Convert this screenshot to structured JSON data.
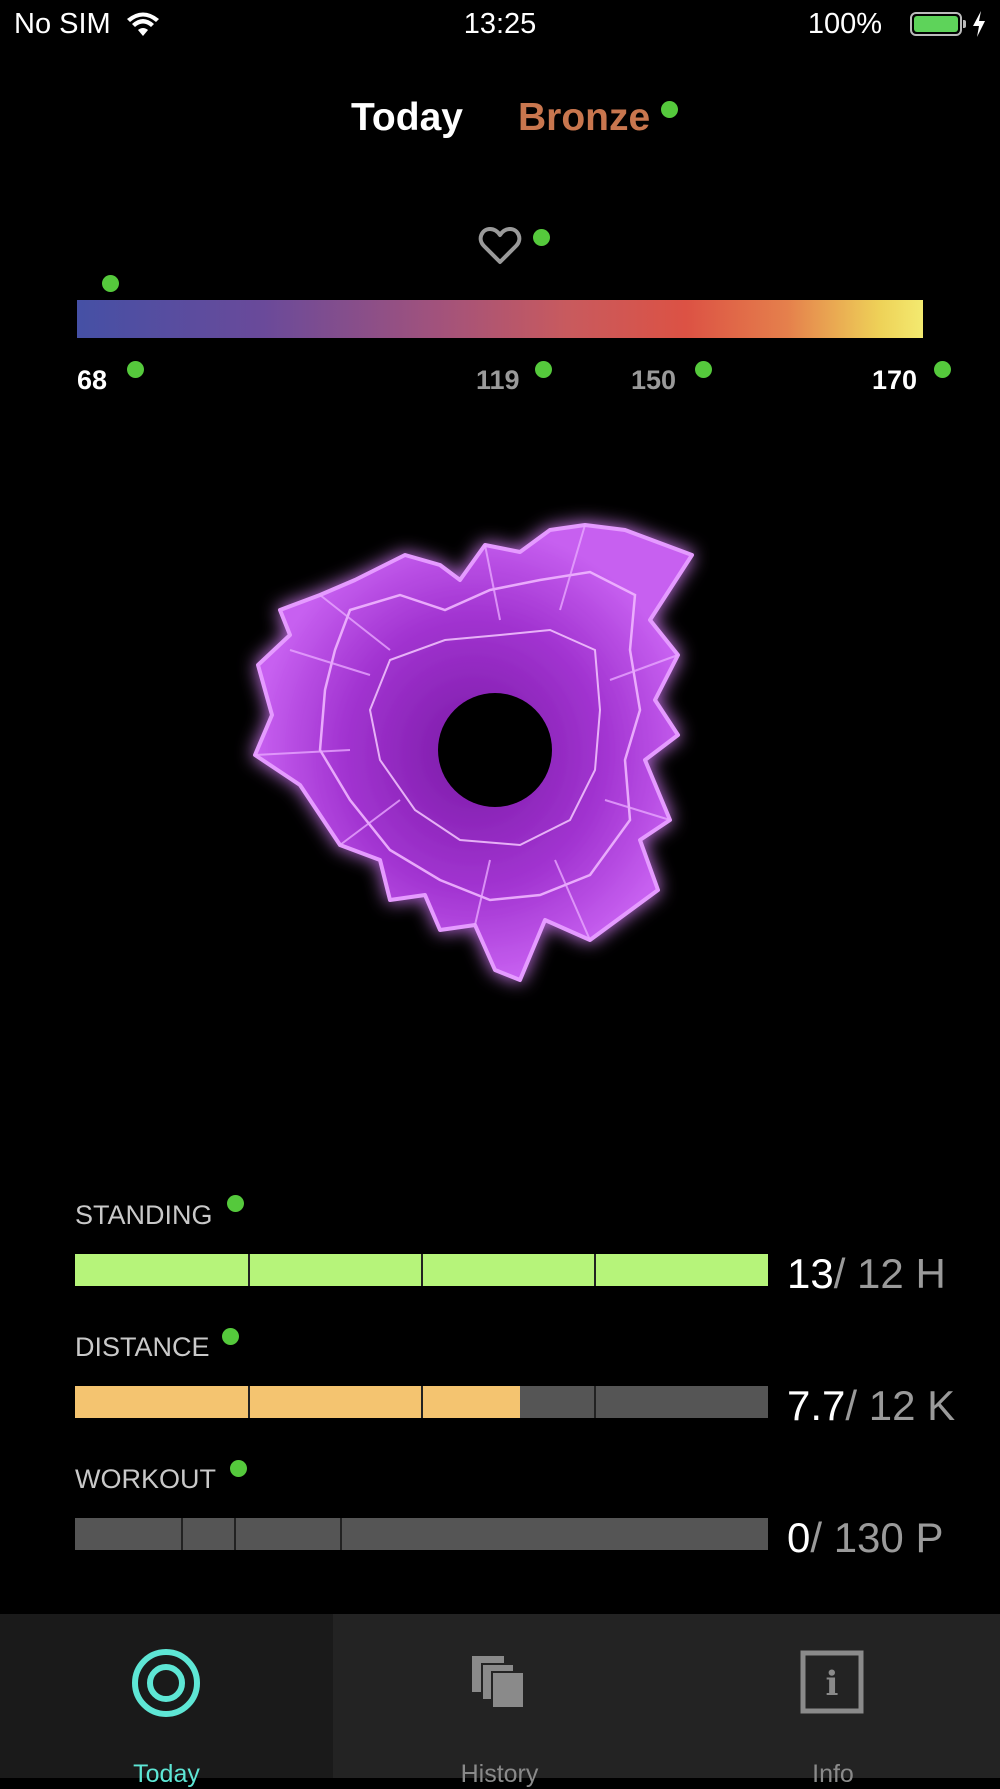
{
  "status_bar": {
    "carrier": "No SIM",
    "time": "13:25",
    "battery_percent": "100%",
    "battery_level": 1.0
  },
  "header": {
    "tab_today": "Today",
    "tab_bronze": "Bronze"
  },
  "heart_rate": {
    "icon": "heart-icon",
    "ticks": [
      "68",
      "119",
      "150",
      "170"
    ],
    "gradient_colors": [
      "#4550a5",
      "#a0527d",
      "#dc5244",
      "#f3ea70"
    ]
  },
  "metrics": {
    "standing": {
      "label": "STANDING",
      "current": "13",
      "goal": "/ 12 H",
      "progress": 1.0,
      "color": "#b6f47a"
    },
    "distance": {
      "label": "DISTANCE",
      "current": "7.7",
      "goal": "/ 12 K",
      "progress": 0.642,
      "color": "#f4c470"
    },
    "workout": {
      "label": "WORKOUT",
      "current": "0",
      "goal": "/ 130 P",
      "progress": 0.0,
      "color": "#b6f47a"
    }
  },
  "tabbar": {
    "items": [
      {
        "label": "Today",
        "icon": "target-icon",
        "active": true,
        "color": "#5ee6d5"
      },
      {
        "label": "History",
        "icon": "stack-icon",
        "active": false
      },
      {
        "label": "Info",
        "icon": "info-icon",
        "active": false
      }
    ]
  },
  "colors": {
    "accent": "#5ee6d5",
    "bronze": "#c8764e",
    "indicator_dot": "#55c93c",
    "visual": "#c54ee8"
  }
}
